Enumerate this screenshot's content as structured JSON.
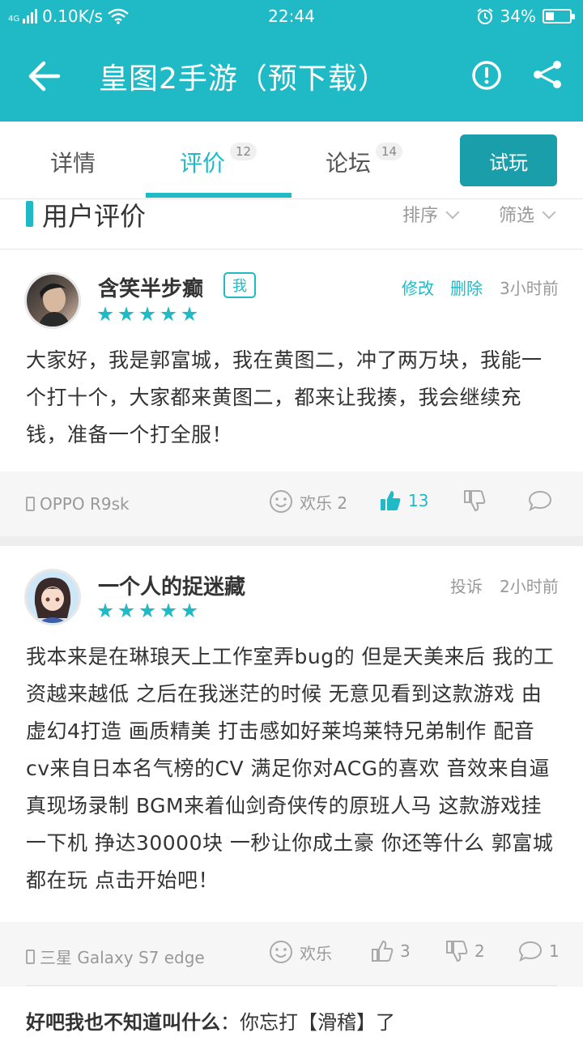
{
  "status": {
    "network": "0.10K/s",
    "time": "22:44",
    "battery": "34%",
    "battery_level": 0.34,
    "signal_label": "4G"
  },
  "appbar": {
    "title": "皇图2手游（预下载）"
  },
  "tabs": [
    {
      "label": "详情",
      "badge": ""
    },
    {
      "label": "评价",
      "badge": "12"
    },
    {
      "label": "论坛",
      "badge": "14"
    }
  ],
  "trial_button": "试玩",
  "section": {
    "title": "用户评价",
    "sort": "排序",
    "filter": "筛选"
  },
  "reviews": [
    {
      "user": "含笑半步癫",
      "me_badge": "我",
      "edit": "修改",
      "delete": "删除",
      "time": "3小时前",
      "rating": 5,
      "text": "大家好，我是郭富城，我在黄图二，冲了两万块，我能一个打十个，大家都来黄图二，都来让我揍，我会继续充钱，准备一个打全服！",
      "device": "OPPO R9sk",
      "fun": "欢乐 2",
      "likes": "13",
      "dislikes": "",
      "comments": ""
    },
    {
      "user": "一个人的捉迷藏",
      "report": "投诉",
      "time": "2小时前",
      "rating": 5,
      "text": "我本来是在琳琅天上工作室弄bug的 但是天美来后 我的工资越来越低 之后在我迷茫的时候 无意见看到这款游戏 由虚幻4打造 画质精美 打击感如好莱坞莱特兄弟制作 配音cv来自日本名气榜的CV 满足你对ACG的喜欢 音效来自逼真现场录制 BGM来着仙剑奇侠传的原班人马 这款游戏挂一下机 挣达30000块 一秒让你成土豪 你还等什么 郭富城都在玩 点击开始吧！",
      "device": "三星 Galaxy S7 edge",
      "fun": "欢乐",
      "likes": "3",
      "dislikes": "2",
      "comments": "1",
      "reply_user": "好吧我也不知道叫什么",
      "reply_text": "：你忘打【滑稽】了"
    }
  ]
}
